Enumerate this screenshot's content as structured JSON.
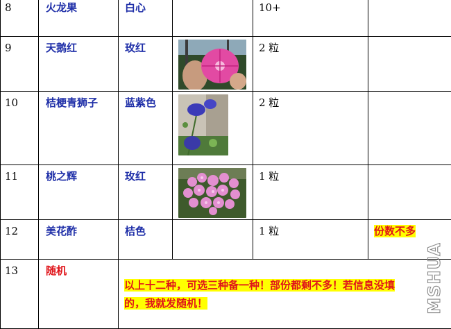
{
  "rows": [
    {
      "num": "8",
      "name": "火龙果",
      "color": "白心",
      "qty": "10+",
      "note": ""
    },
    {
      "num": "9",
      "name": "天鹅红",
      "color": "玫红",
      "qty": "2 粒",
      "note": ""
    },
    {
      "num": "10",
      "name": "桔梗青狮子",
      "color": "蓝紫色",
      "qty": "2 粒",
      "note": ""
    },
    {
      "num": "11",
      "name": "桃之辉",
      "color": "玫红",
      "qty": "1 粒",
      "note": ""
    },
    {
      "num": "12",
      "name": "美花酢",
      "color": "桔色",
      "qty": "1 粒",
      "note": "份数不多"
    },
    {
      "num": "13",
      "name": "随机"
    }
  ],
  "footer": {
    "line1": "以上十二种，可选三种备一种！部份都剩不多！若信息没填",
    "line2": "的，我就发随机！"
  },
  "watermark": {
    "text": "MSHUA"
  },
  "colors": {
    "name_blue": "#1f2fa8",
    "red": "#e0141a",
    "highlight": "#ffff00"
  },
  "icons": {
    "row9": "pink-morning-glory-photo",
    "row10": "blue-morning-glory-photo",
    "row11": "pink-flower-cluster-photo"
  }
}
